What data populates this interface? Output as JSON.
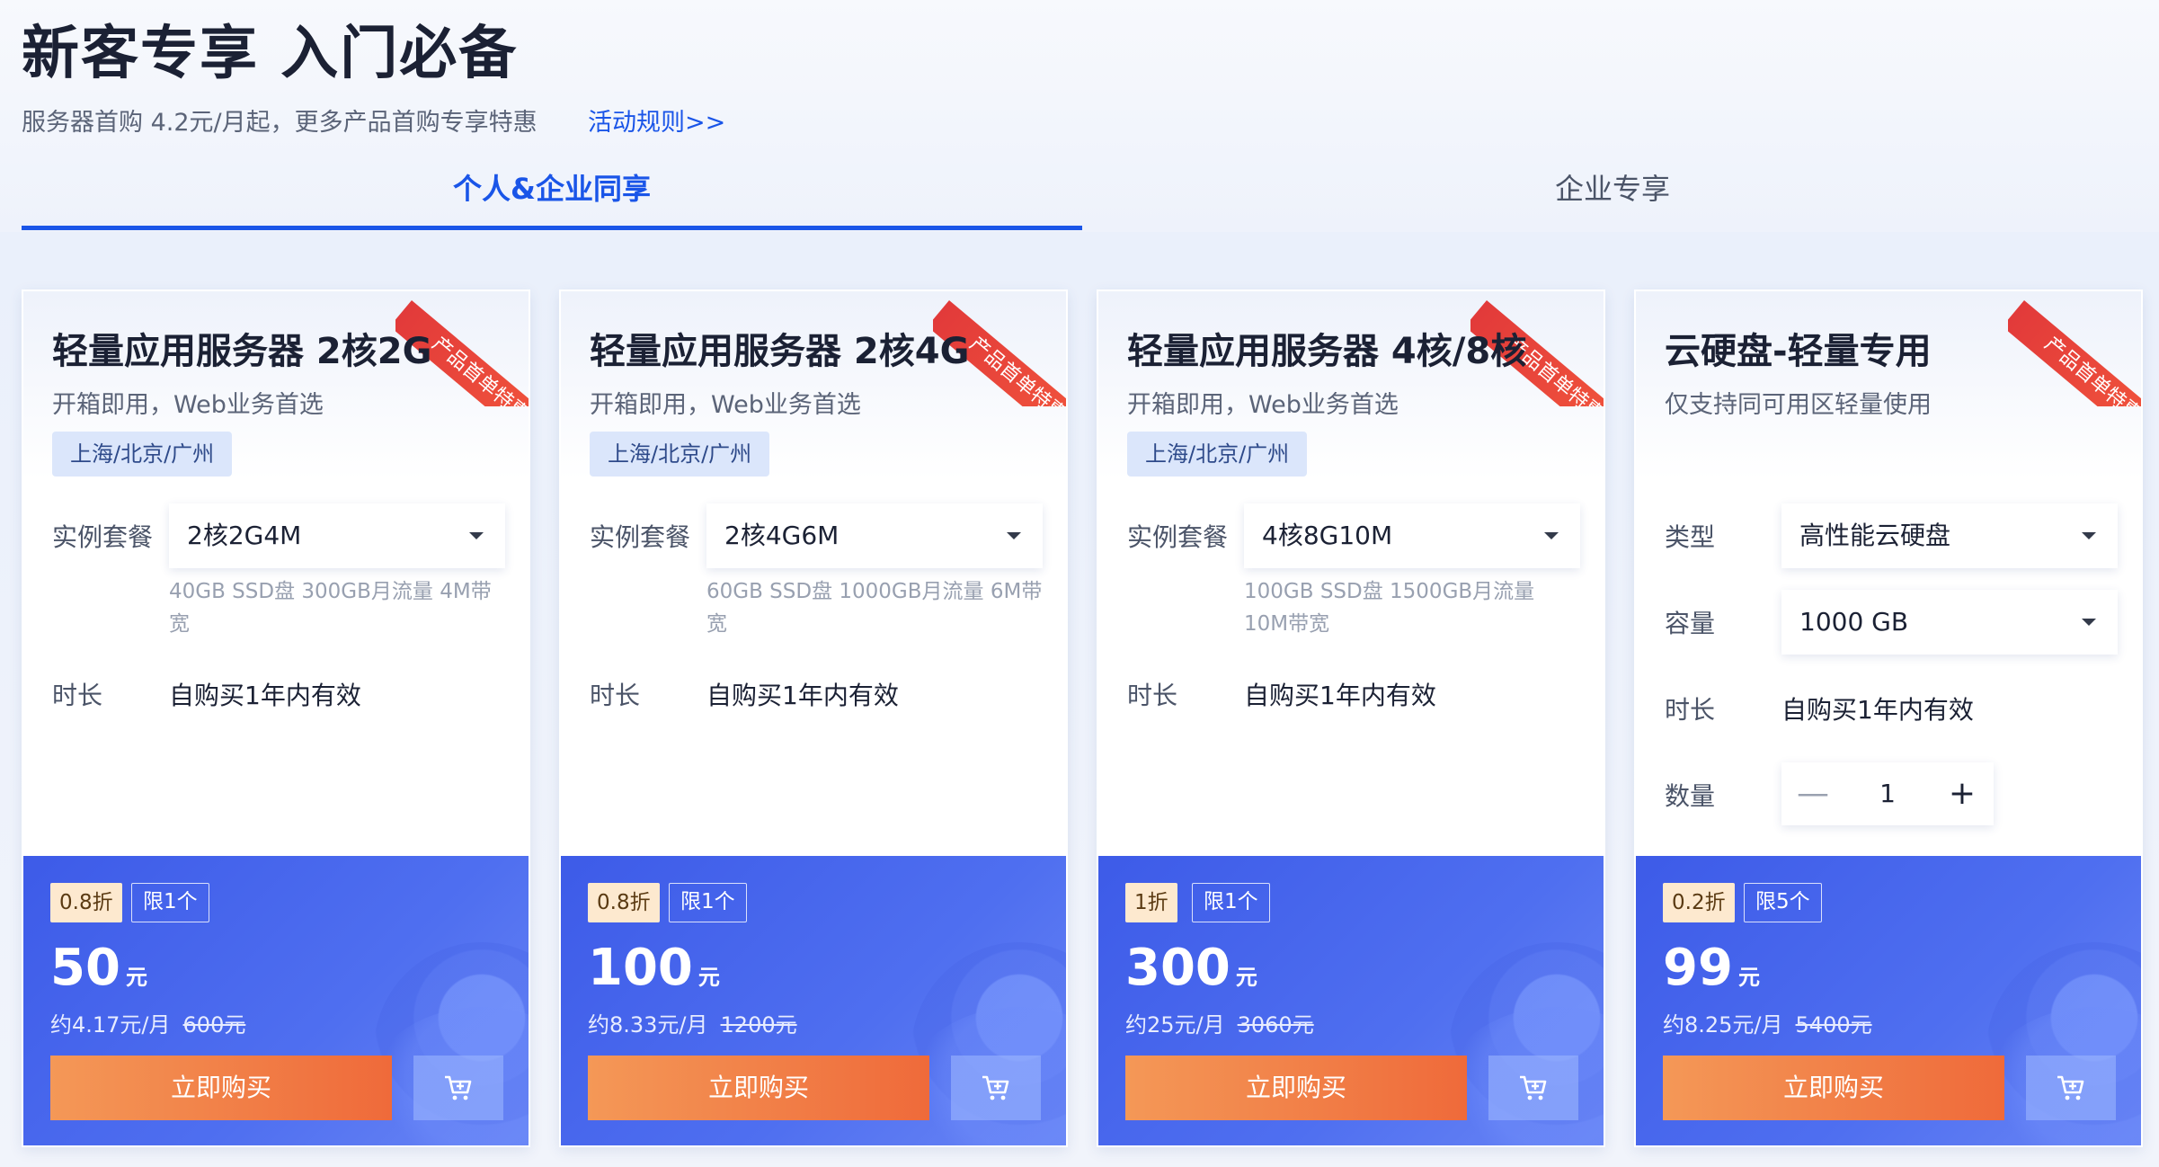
{
  "header": {
    "title": "新客专享 入门必备",
    "subtitle": "服务器首购 4.2元/月起，更多产品首购专享特惠",
    "rules_link": "活动规则>>"
  },
  "tabs": [
    {
      "label": "个人&企业同享",
      "active": true
    },
    {
      "label": "企业专享",
      "active": false
    }
  ],
  "colors": {
    "accent": "#1a55e8",
    "ribbon": "#e23a3a",
    "price_panel": "#3d5be8",
    "buy_button": "#ef6a3a"
  },
  "cards": [
    {
      "ribbon": "产品首单特惠",
      "title": "轻量应用服务器 2核2G",
      "desc": "开箱即用，Web业务首选",
      "region": "上海/北京/广州",
      "plan_label": "实例套餐",
      "plan_value": "2核2G4M",
      "plan_note": "40GB SSD盘 300GB月流量 4M带宽",
      "duration_label": "时长",
      "duration_value": "自购买1年内有效",
      "discount": "0.8折",
      "limit": "限1个",
      "price": "50",
      "price_unit": "元",
      "monthly": "约4.17元/月",
      "original": "600元",
      "buy_label": "立即购买"
    },
    {
      "ribbon": "产品首单特惠",
      "title": "轻量应用服务器 2核4G",
      "desc": "开箱即用，Web业务首选",
      "region": "上海/北京/广州",
      "plan_label": "实例套餐",
      "plan_value": "2核4G6M",
      "plan_note": "60GB SSD盘 1000GB月流量 6M带宽",
      "duration_label": "时长",
      "duration_value": "自购买1年内有效",
      "discount": "0.8折",
      "limit": "限1个",
      "price": "100",
      "price_unit": "元",
      "monthly": "约8.33元/月",
      "original": "1200元",
      "buy_label": "立即购买"
    },
    {
      "ribbon": "产品首单特惠",
      "title": "轻量应用服务器 4核/8核",
      "desc": "开箱即用，Web业务首选",
      "region": "上海/北京/广州",
      "plan_label": "实例套餐",
      "plan_value": "4核8G10M",
      "plan_note": "100GB SSD盘 1500GB月流量 10M带宽",
      "duration_label": "时长",
      "duration_value": "自购买1年内有效",
      "discount": "1折",
      "limit": "限1个",
      "price": "300",
      "price_unit": "元",
      "monthly": "约25元/月",
      "original": "3060元",
      "buy_label": "立即购买"
    },
    {
      "ribbon": "产品首单特惠",
      "title": "云硬盘-轻量专用",
      "desc": "仅支持同可用区轻量使用",
      "type_label": "类型",
      "type_value": "高性能云硬盘",
      "capacity_label": "容量",
      "capacity_value": "1000 GB",
      "duration_label": "时长",
      "duration_value": "自购买1年内有效",
      "quantity_label": "数量",
      "quantity_minus": "—",
      "quantity_value": "1",
      "quantity_plus": "+",
      "discount": "0.2折",
      "limit": "限5个",
      "price": "99",
      "price_unit": "元",
      "monthly": "约8.25元/月",
      "original": "5400元",
      "buy_label": "立即购买"
    }
  ]
}
